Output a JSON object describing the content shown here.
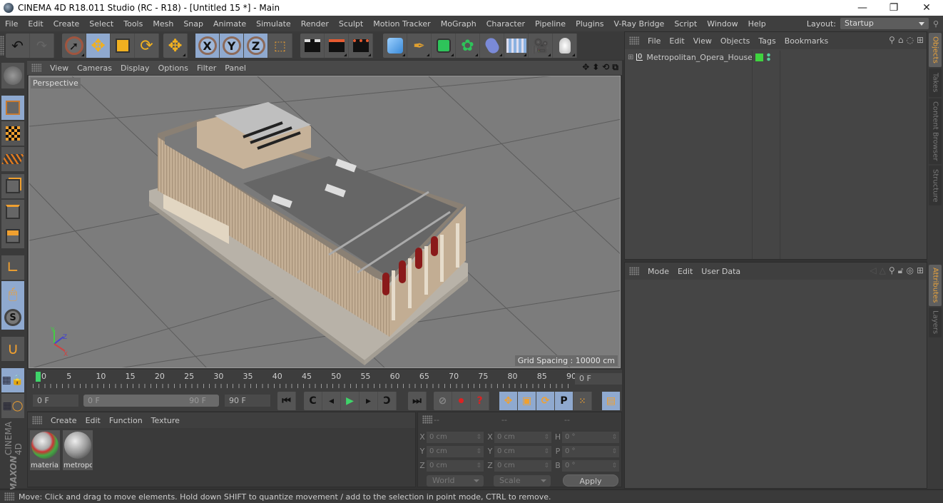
{
  "window": {
    "title": "CINEMA 4D R18.011 Studio (RC - R18) - [Untitled 15 *] - Main",
    "controls": [
      "minimize",
      "restore",
      "close"
    ]
  },
  "menubar": {
    "items": [
      "File",
      "Edit",
      "Create",
      "Select",
      "Tools",
      "Mesh",
      "Snap",
      "Animate",
      "Simulate",
      "Render",
      "Sculpt",
      "Motion Tracker",
      "MoGraph",
      "Character",
      "Pipeline",
      "Plugins",
      "V-Ray Bridge",
      "Script",
      "Window",
      "Help"
    ],
    "layout_label": "Layout:",
    "layout_value": "Startup"
  },
  "toolbar": {
    "groups": [
      {
        "name": "history",
        "tools": [
          "undo-icon",
          "redo-icon"
        ]
      },
      {
        "name": "transform",
        "tools": [
          "live-selection-icon",
          "move-icon",
          "scale-icon",
          "rotate-icon"
        ]
      },
      {
        "name": "recent",
        "tools": [
          "move-icon"
        ]
      },
      {
        "name": "axis-lock",
        "tools": [
          "x-axis-icon",
          "y-axis-icon",
          "z-axis-icon",
          "coordinate-system-icon"
        ]
      },
      {
        "name": "render",
        "tools": [
          "render-view-icon",
          "render-picture-viewer-icon",
          "render-settings-icon"
        ]
      },
      {
        "name": "objects",
        "tools": [
          "cube-icon",
          "pen-spline-icon",
          "subdivision-icon",
          "cloner-icon",
          "deformer-icon",
          "floor-icon",
          "camera-icon",
          "light-icon"
        ]
      }
    ],
    "axis_labels": [
      "X",
      "Y",
      "Z"
    ]
  },
  "left_tools": [
    "make-editable-icon",
    "model-mode-icon",
    "texture-mode-icon",
    "points-mode-icon",
    "edges-mode-icon",
    "polygons-mode-icon",
    "axis-mode-icon",
    "tweak-mode-icon",
    "solo-icon",
    "snap-icon",
    "workplane-lock-icon",
    "workplane-icon"
  ],
  "viewport": {
    "menu": [
      "View",
      "Cameras",
      "Display",
      "Options",
      "Filter",
      "Panel"
    ],
    "camera_label": "Perspective",
    "grid_spacing": "Grid Spacing : 10000 cm",
    "nav_icons": [
      "pan-icon",
      "dolly-icon",
      "orbit-icon",
      "maximize-icon"
    ],
    "axis_gizmo": [
      "Y",
      "Z",
      "X"
    ],
    "colors": {
      "background": "#7c7c7c",
      "building_wall": "#c8b49c",
      "roof": "#6e6e6e",
      "base": "#b8b2a8",
      "accent_red": "#8a1a1a"
    }
  },
  "timeline": {
    "ticks": [
      "0",
      "5",
      "10",
      "15",
      "20",
      "25",
      "30",
      "35",
      "40",
      "45",
      "50",
      "55",
      "60",
      "65",
      "70",
      "75",
      "80",
      "85",
      "90"
    ],
    "current_frame": "0 F",
    "start_field": "0 F",
    "range_start": "0 F",
    "range_end": "90 F",
    "end_field": "90 F",
    "playhead_color": "#3fd46a"
  },
  "playback": {
    "buttons": [
      "go-to-start-icon",
      "previous-key-icon",
      "previous-frame-icon",
      "play-icon",
      "next-frame-icon",
      "next-key-icon",
      "go-to-end-icon",
      "record-disabled-icon",
      "autokey-icon",
      "keyframe-selection-icon",
      "key-position-icon",
      "key-scale-icon",
      "key-rotation-icon",
      "key-param-icon",
      "key-pla-icon",
      "timeline-icon"
    ],
    "param_label": "P"
  },
  "material_manager": {
    "menu": [
      "Create",
      "Edit",
      "Function",
      "Texture"
    ],
    "materials": [
      {
        "name": "material"
      },
      {
        "name": "metropo"
      }
    ]
  },
  "coordinates": {
    "headers": [
      "--",
      "--",
      "--"
    ],
    "rows": [
      {
        "pos_axis": "X",
        "pos": "0 cm",
        "size_axis": "X",
        "size": "0 cm",
        "rot_axis": "H",
        "rot": "0 °"
      },
      {
        "pos_axis": "Y",
        "pos": "0 cm",
        "size_axis": "Y",
        "size": "0 cm",
        "rot_axis": "P",
        "rot": "0 °"
      },
      {
        "pos_axis": "Z",
        "pos": "0 cm",
        "size_axis": "Z",
        "size": "0 cm",
        "rot_axis": "B",
        "rot": "0 °"
      }
    ],
    "space": "World",
    "mode": "Scale",
    "apply_label": "Apply"
  },
  "object_manager": {
    "menu": [
      "File",
      "Edit",
      "View",
      "Objects",
      "Tags",
      "Bookmarks"
    ],
    "objects": [
      {
        "name": "Metropolitan_Opera_House",
        "type": "null-icon",
        "visible_color": "#3fd43f"
      }
    ]
  },
  "attribute_manager": {
    "menu": [
      "Mode",
      "Edit",
      "User Data"
    ]
  },
  "side_tabs": {
    "top": [
      {
        "label": "Objects",
        "active": true
      },
      {
        "label": "Takes",
        "active": false
      },
      {
        "label": "Content Browser",
        "active": false
      },
      {
        "label": "Structure",
        "active": false
      }
    ],
    "bottom": [
      {
        "label": "Attributes",
        "active": true
      },
      {
        "label": "Layers",
        "active": false
      }
    ]
  },
  "brand": {
    "line1": "MAXON",
    "line2": "CINEMA 4D"
  },
  "status_bar": {
    "message": "Move: Click and drag to move elements. Hold down SHIFT to quantize movement / add to the selection in point mode, CTRL to remove."
  }
}
